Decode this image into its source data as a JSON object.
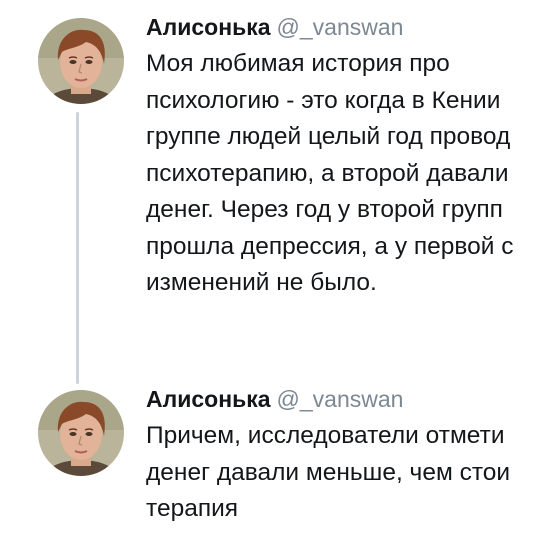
{
  "tweets": [
    {
      "author": {
        "display_name": "Алисонька",
        "handle": "@_vanswan"
      },
      "lines": [
        "Моя любимая история про",
        "психологию - это когда в Кении",
        "группе людей целый год провод",
        "психотерапию, а второй давали",
        "денег. Через год у второй групп",
        "прошла депрессия, а у первой с",
        "изменений не было."
      ]
    },
    {
      "author": {
        "display_name": "Алисонька",
        "handle": "@_vanswan"
      },
      "lines": [
        "Причем, исследователи отмети",
        "денег давали меньше, чем стои",
        "терапия"
      ]
    }
  ],
  "colors": {
    "text": "#14171a",
    "handle": "#7d8893",
    "thread_line": "#cdd3d8"
  },
  "icons": {
    "avatar": "user-avatar-photo"
  }
}
